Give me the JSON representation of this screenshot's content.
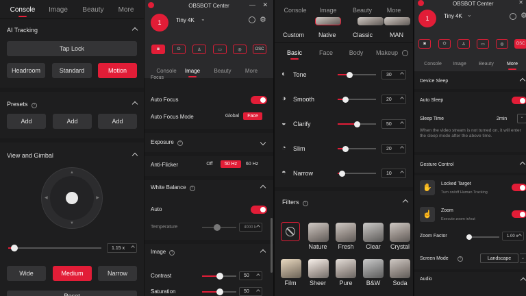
{
  "p1": {
    "tabs": [
      "Console",
      "Image",
      "Beauty",
      "More"
    ],
    "ai_tracking": "AI Tracking",
    "tap_lock": "Tap Lock",
    "modes": [
      "Headroom",
      "Standard",
      "Motion"
    ],
    "presets": "Presets",
    "add": [
      "Add",
      "Add",
      "Add"
    ],
    "view_gimbal": "View and Gimbal",
    "zoom_value": "1.15 x",
    "views": [
      "Wide",
      "Medium",
      "Narrow"
    ],
    "reset": "Reset"
  },
  "p2": {
    "title": "OBSBOT Center",
    "device_num": "1",
    "device": "Tiny 4K",
    "osc": "OSC",
    "tabs": [
      "Console",
      "Image",
      "Beauty",
      "More"
    ],
    "focus_cut": "Focus",
    "auto_focus": "Auto Focus",
    "af_mode": "Auto Focus Mode",
    "af_opts": [
      "Global",
      "Face"
    ],
    "exposure": "Exposure",
    "anti_flicker": "Anti-Flicker",
    "flicker_opts": [
      "Off",
      "50 Hz",
      "60 Hz"
    ],
    "white_balance": "White Balance",
    "auto": "Auto",
    "temperature": "Temperature",
    "temp_value": "4000 k",
    "image": "Image",
    "contrast": "Contrast",
    "contrast_value": "50",
    "saturation": "Saturation",
    "saturation_value": "50"
  },
  "p3": {
    "tabs": [
      "Console",
      "Image",
      "Beauty",
      "More"
    ],
    "styles": [
      "Custom",
      "Native",
      "Classic",
      "MAN"
    ],
    "subtabs": [
      "Basic",
      "Face",
      "Body",
      "Makeup"
    ],
    "items": [
      {
        "label": "Tone",
        "value": "30",
        "level": 0.3
      },
      {
        "label": "Smooth",
        "value": "20",
        "level": 0.2
      },
      {
        "label": "Clarify",
        "value": "50",
        "level": 0.5
      },
      {
        "label": "Slim",
        "value": "20",
        "level": 0.2
      },
      {
        "label": "Narrow",
        "value": "10",
        "level": 0.1
      }
    ],
    "filters": "Filters",
    "filter_row1": [
      "Nature",
      "Fresh",
      "Clear",
      "Crystal"
    ],
    "filter_row2": [
      "Film",
      "Sheer",
      "Pure",
      "B&W",
      "Soda"
    ]
  },
  "p4": {
    "title": "OBSBOT Center",
    "device_num": "1",
    "device": "Tiny 4K",
    "osc": "OSC",
    "tabs": [
      "Console",
      "Image",
      "Beauty",
      "More"
    ],
    "device_sleep": "Device Sleep",
    "auto_sleep": "Auto Sleep",
    "sleep_time": "Sleep Time",
    "sleep_value": "2min",
    "sleep_desc": "When the video stream is not turned on, it will enter the sleep mode after the above time.",
    "gesture": "Gesture Control",
    "locked": "Locked Target",
    "locked_desc": "Turn on/off Human Tracking",
    "zoom": "Zoom",
    "zoom_desc": "Execute zoom in/out",
    "zoom_factor": "Zoom Factor",
    "zoom_factor_value": "1.00 x",
    "screen_mode": "Screen Mode",
    "screen_value": "Landscape",
    "audio": "Audio"
  },
  "colors": {
    "accent": "#e21d37",
    "panel": "#1e1e1f",
    "panel_alt": "#2a2a2c"
  }
}
